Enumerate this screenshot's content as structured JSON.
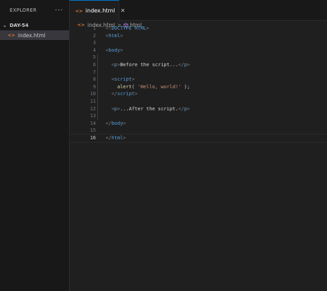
{
  "sidebar": {
    "header": "EXPLORER",
    "more_label": "···",
    "folder": "DAY-54",
    "files": [
      {
        "name": "index.html",
        "icon": "html-icon",
        "glyph": "<>"
      }
    ]
  },
  "editor": {
    "tab": {
      "label": "index.html",
      "icon": "html-icon",
      "glyph": "<>",
      "close": "✕"
    },
    "breadcrumb": {
      "file": "index.html",
      "sep": ">",
      "element": "html"
    },
    "current_line": 16,
    "lines": [
      {
        "n": "1",
        "segments": [
          [
            "b",
            "<!"
          ],
          [
            "t",
            "DOCTYPE"
          ],
          [
            "x",
            " "
          ],
          [
            "t",
            "HTML"
          ],
          [
            "b",
            ">"
          ]
        ]
      },
      {
        "n": "2",
        "segments": [
          [
            "b",
            "<"
          ],
          [
            "t",
            "html"
          ],
          [
            "b",
            ">"
          ]
        ]
      },
      {
        "n": "3",
        "segments": []
      },
      {
        "n": "4",
        "segments": [
          [
            "b",
            "<"
          ],
          [
            "t",
            "body"
          ],
          [
            "b",
            ">"
          ]
        ]
      },
      {
        "n": "5",
        "segments": []
      },
      {
        "n": "6",
        "segments": [
          [
            "x",
            "  "
          ],
          [
            "b",
            "<"
          ],
          [
            "t",
            "p"
          ],
          [
            "b",
            ">"
          ],
          [
            "x",
            "Before the script..."
          ],
          [
            "b",
            "</"
          ],
          [
            "t",
            "p"
          ],
          [
            "b",
            ">"
          ]
        ]
      },
      {
        "n": "7",
        "segments": []
      },
      {
        "n": "8",
        "segments": [
          [
            "x",
            "  "
          ],
          [
            "b",
            "<"
          ],
          [
            "t",
            "script"
          ],
          [
            "b",
            ">"
          ]
        ]
      },
      {
        "n": "9",
        "segments": [
          [
            "x",
            "    "
          ],
          [
            "f",
            "alert"
          ],
          [
            "x",
            "( "
          ],
          [
            "s",
            "'Hello, world!'"
          ],
          [
            "x",
            " );"
          ]
        ]
      },
      {
        "n": "10",
        "segments": [
          [
            "x",
            "  "
          ],
          [
            "b",
            "</"
          ],
          [
            "t",
            "script"
          ],
          [
            "b",
            ">"
          ]
        ]
      },
      {
        "n": "11",
        "segments": []
      },
      {
        "n": "12",
        "segments": [
          [
            "x",
            "  "
          ],
          [
            "b",
            "<"
          ],
          [
            "t",
            "p"
          ],
          [
            "b",
            ">"
          ],
          [
            "x",
            "...After the script."
          ],
          [
            "b",
            "</"
          ],
          [
            "t",
            "p"
          ],
          [
            "b",
            ">"
          ]
        ]
      },
      {
        "n": "13",
        "segments": []
      },
      {
        "n": "14",
        "segments": [
          [
            "b",
            "</"
          ],
          [
            "t",
            "body"
          ],
          [
            "b",
            ">"
          ]
        ]
      },
      {
        "n": "15",
        "segments": []
      },
      {
        "n": "16",
        "segments": [
          [
            "b",
            "</"
          ],
          [
            "t",
            "html"
          ],
          [
            "b",
            ">"
          ]
        ]
      }
    ]
  },
  "colors": {
    "tag": "#569cd6",
    "bracket": "#808080",
    "string": "#ce9178",
    "function": "#dcdcaa",
    "html_icon": "#e37933",
    "accent": "#0078d4"
  }
}
